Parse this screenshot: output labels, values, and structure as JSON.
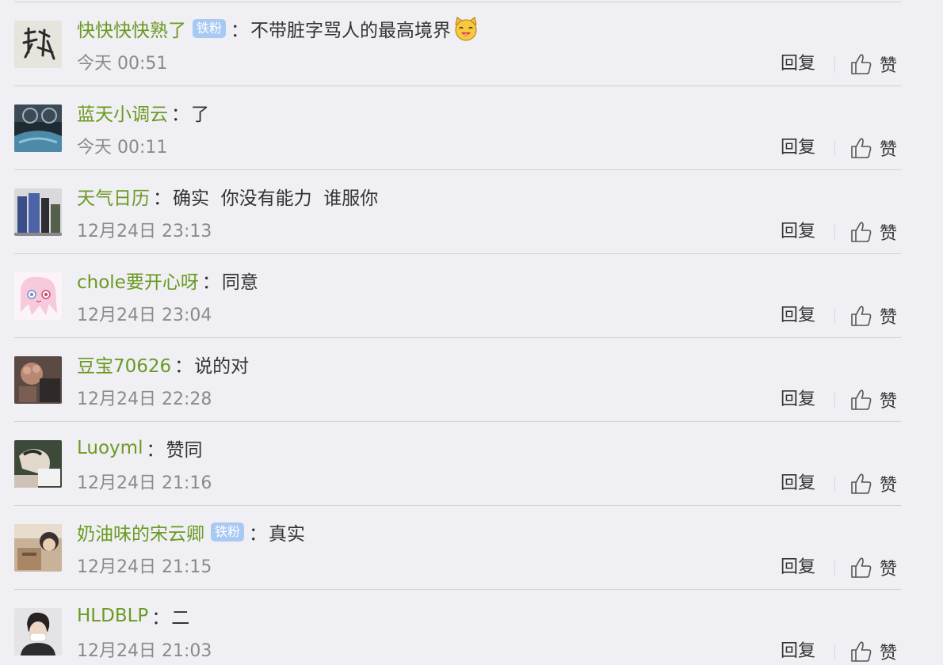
{
  "comments": [
    {
      "user": "快快快快熟了",
      "badge": "铁粉",
      "colon": "：",
      "text": "不带脏字骂人的最高境界",
      "emoji": "smiling-cat-emoji",
      "time": "今天 00:51",
      "reply": "回复",
      "like": "赞"
    },
    {
      "user": "蓝天小调云",
      "badge": "",
      "colon": "：",
      "text": "了",
      "time": "今天 00:11",
      "reply": "回复",
      "like": "赞"
    },
    {
      "user": "天气日历",
      "badge": "",
      "colon": "：",
      "text": "确实  你没有能力  谁服你",
      "time": "12月24日 23:13",
      "reply": "回复",
      "like": "赞"
    },
    {
      "user": "chole要开心呀",
      "badge": "",
      "colon": "：",
      "text": "同意",
      "time": "12月24日 23:04",
      "reply": "回复",
      "like": "赞"
    },
    {
      "user": "豆宝70626",
      "badge": "",
      "colon": "：",
      "text": "说的对",
      "time": "12月24日 22:28",
      "reply": "回复",
      "like": "赞"
    },
    {
      "user": "Luoyml",
      "badge": "",
      "colon": "：",
      "text": "赞同",
      "time": "12月24日 21:16",
      "reply": "回复",
      "like": "赞"
    },
    {
      "user": "奶油味的宋云卿",
      "badge": "铁粉",
      "colon": "：",
      "text": "真实",
      "time": "12月24日 21:15",
      "reply": "回复",
      "like": "赞"
    },
    {
      "user": "HLDBLP",
      "badge": "",
      "colon": "：",
      "text": "二",
      "time": "12月24日 21:03",
      "reply": "回复",
      "like": "赞"
    }
  ],
  "colors": {
    "background": "#f0eff4",
    "username": "#6a9a22",
    "badge": "#a7c9f3",
    "text": "#333333",
    "time": "#8a8a8a"
  },
  "icons": {
    "like": "thumbs-up-icon",
    "emoji": "smiling-cat-emoji"
  }
}
